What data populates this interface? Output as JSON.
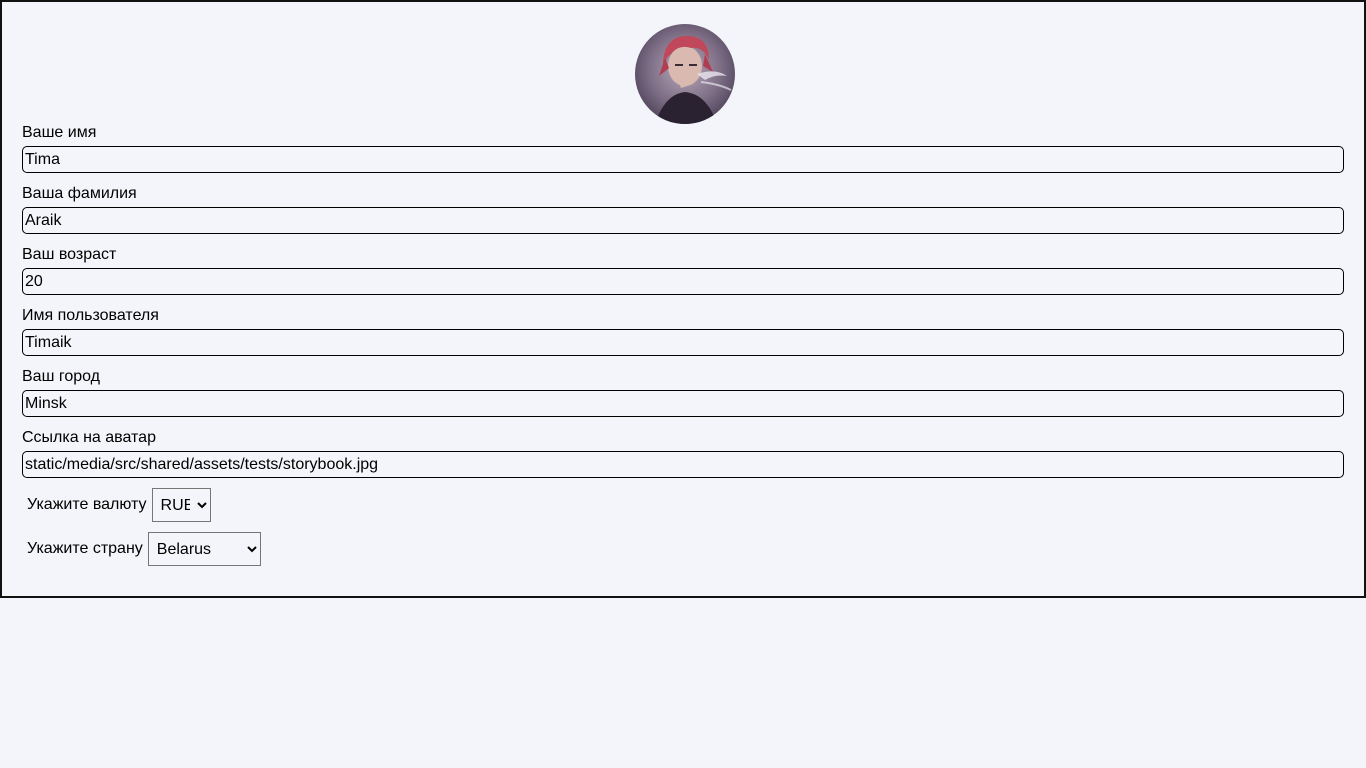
{
  "profile": {
    "avatar_alt": "avatar",
    "fields": [
      {
        "label": "Ваше имя",
        "value": "Tima"
      },
      {
        "label": "Ваша фамилия",
        "value": "Araik"
      },
      {
        "label": "Ваш возраст",
        "value": "20"
      },
      {
        "label": "Имя пользователя",
        "value": "Timaik"
      },
      {
        "label": "Ваш город",
        "value": "Minsk"
      },
      {
        "label": "Ссылка на аватар",
        "value": "static/media/src/shared/assets/tests/storybook.jpg"
      }
    ],
    "currency": {
      "label": "Укажите валюту",
      "selected": "RUB"
    },
    "country": {
      "label": "Укажите страну",
      "selected": "Belarus"
    }
  },
  "colors": {
    "background": "#f4f5fa",
    "border": "#111111"
  }
}
